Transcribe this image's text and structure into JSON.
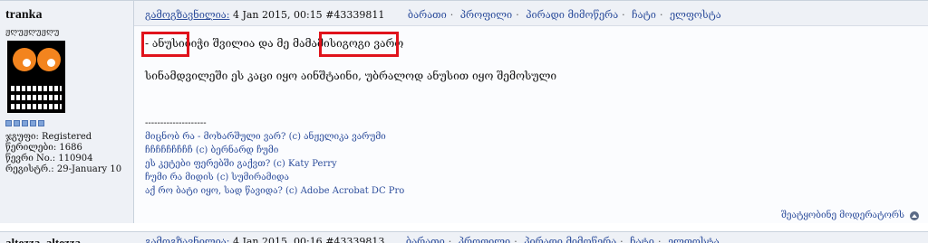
{
  "post": {
    "username": "tranka",
    "user_title": "ჟღუჟღუჟღუ",
    "user_info": [
      "ჯგუფი: Registered",
      "წერილები: 1686",
      "წევრი No.: 110904",
      "რეგისტრ.: 29-January 10"
    ],
    "header": {
      "label": "გამოგზავნილია:",
      "datetime": "4 Jan 2015, 00:15",
      "post_id": "#43339811",
      "links": [
        "ბარათი",
        "პროფილი",
        "პირადი მიმოწერა",
        "ჩატი",
        "ელფოსტა"
      ]
    },
    "body_line1_a": "- ანუსი",
    "body_line1_b": "ბიჭი შვილია და მე მამამისი",
    "body_line1_c": "გოგი ვარო",
    "body_line2": "სინამდვილეში ეს კაცი იყო აინშტაინი, უბრალოდ ანუსით იყო შემოსული",
    "signature": {
      "divider": "--------------------",
      "lines": [
        "მიცნობ რა - მოხარშული ვარ? (c) ანჟელიკა ვარუმი",
        "ჩჩჩჩჩჩჩჩჩ (c) ბერნარდ ჩუმი",
        "ეს კეტები ფერებში გაქვთ? (c) Katy Perry",
        "ჩუმი რა მიდის (c) სუმირამიდა",
        "აქ რო ბატი იყო, სად წავიდა? (c) Adobe Acrobat DC Pro"
      ]
    },
    "footer_link": "შეატყობინე მოდერატორს"
  },
  "next_post": {
    "username": "altezza_altezza",
    "header": {
      "label": "გამოგზავნილია:",
      "datetime": "4 Jan 2015, 00:16",
      "post_id": "#43339813",
      "links": [
        "ბარათი",
        "პროფილი",
        "პირადი მიმოწერა",
        "ჩატი",
        "ელფოსტა"
      ]
    }
  },
  "colors": {
    "link": "#2b4c9b",
    "highlight": "#e0121b",
    "panel": "#eef1f6"
  }
}
